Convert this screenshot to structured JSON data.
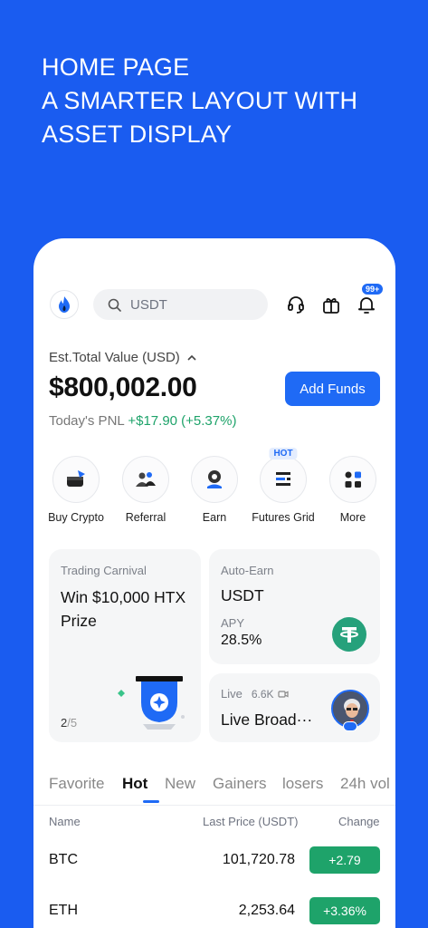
{
  "headline": {
    "line1": "HOME PAGE",
    "line2": "A SMARTER LAYOUT WITH",
    "line3": "ASSET DISPLAY"
  },
  "topbar": {
    "search_placeholder": "USDT",
    "notification_badge": "99+",
    "icons": [
      "logo-icon",
      "support-headset-icon",
      "gift-icon",
      "bell-icon"
    ]
  },
  "assets": {
    "est_label": "Est.Total Value (USD)",
    "total_value": "$800,002.00",
    "pnl_label": "Today's PNL",
    "pnl_value": "+$17.90 (+5.37%)",
    "add_funds_label": "Add Funds"
  },
  "actions": [
    {
      "label": "Buy Crypto",
      "icon": "wallet-icon"
    },
    {
      "label": "Referral",
      "icon": "referral-users-icon"
    },
    {
      "label": "Earn",
      "icon": "earn-coin-icon"
    },
    {
      "label": "Futures Grid",
      "icon": "futures-grid-icon",
      "tag": "HOT"
    },
    {
      "label": "More",
      "icon": "more-grid-icon"
    }
  ],
  "cards": {
    "carnival": {
      "subtitle": "Trading Carnival",
      "title": "Win $10,000 HTX Prize",
      "page_current": "2",
      "page_total": "/5"
    },
    "auto_earn": {
      "subtitle": "Auto-Earn",
      "coin": "USDT",
      "apy_label": "APY",
      "apy_value": "28.5%"
    },
    "live": {
      "subtitle": "Live",
      "viewers": "6.6K",
      "title": "Live Broad···"
    }
  },
  "market": {
    "tabs": [
      "Favorite",
      "Hot",
      "New",
      "Gainers",
      "losers",
      "24h vol"
    ],
    "active_tab": "Hot",
    "columns": {
      "name": "Name",
      "price": "Last Price (USDT)",
      "change": "Change"
    },
    "rows": [
      {
        "symbol": "BTC",
        "price": "101,720.78",
        "change": "+2.79"
      },
      {
        "symbol": "ETH",
        "price": "2,253.64",
        "change": "+3.36%"
      }
    ]
  },
  "colors": {
    "background": "#1a5cf0",
    "accent": "#1f6af5",
    "gain": "#1ea36a"
  }
}
